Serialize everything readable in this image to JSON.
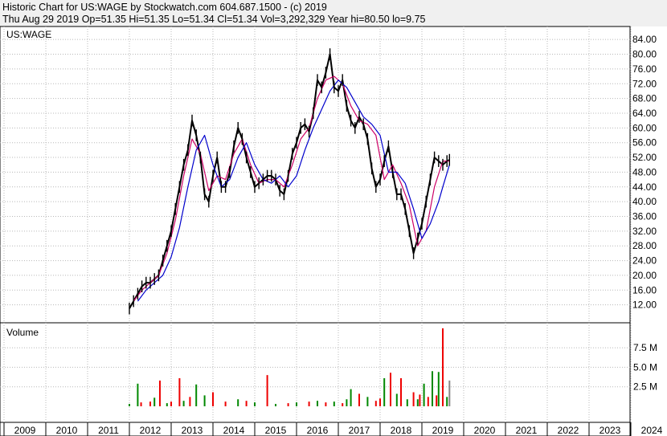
{
  "header": {
    "line1": "Historic Chart for US:WAGE by Stockwatch.com 604.687.1500 - (c) 2019",
    "line2": "Thu Aug 29 2019  Op=51.35  Hi=51.35  Lo=51.34  Cl=51.34  Vol=3,292,329  Year hi=80.50  lo=9.75"
  },
  "chart_data": [
    {
      "type": "line",
      "title": "US:WAGE",
      "ylim": [
        8,
        86
      ],
      "y_ticks": [
        "84.00",
        "80.00",
        "76.00",
        "72.00",
        "68.00",
        "64.00",
        "60.00",
        "56.00",
        "52.00",
        "48.00",
        "44.00",
        "40.00",
        "36.00",
        "32.00",
        "28.00",
        "24.00",
        "20.00",
        "16.00",
        "12.00"
      ],
      "x_ticks": [
        "2009",
        "2010",
        "2011",
        "2012",
        "2013",
        "2014",
        "2015",
        "2016",
        "2017",
        "2018",
        "2019",
        "2020",
        "2021",
        "2022",
        "2023",
        "2024"
      ],
      "grid": true,
      "colors": {
        "price": "#000000",
        "ma_short": "#cc0066",
        "ma_long": "#0000cc"
      },
      "series": [
        {
          "values_x": [
            2012.0,
            2012.1,
            2012.2,
            2012.3,
            2012.4,
            2012.5,
            2012.6,
            2012.7,
            2012.8,
            2012.9,
            2013.0,
            2013.1,
            2013.2,
            2013.3,
            2013.4,
            2013.5,
            2013.6,
            2013.7,
            2013.8,
            2013.9,
            2014.0,
            2014.1,
            2014.2,
            2014.3,
            2014.4,
            2014.5,
            2014.6,
            2014.7,
            2014.8,
            2014.9,
            2015.0,
            2015.1,
            2015.2,
            2015.3,
            2015.4,
            2015.5,
            2015.6,
            2015.7,
            2015.8,
            2015.9,
            2016.0,
            2016.1,
            2016.2,
            2016.3,
            2016.4,
            2016.5,
            2016.6,
            2016.7,
            2016.8,
            2016.9,
            2017.0,
            2017.1,
            2017.2,
            2017.3,
            2017.4,
            2017.5,
            2017.6,
            2017.7,
            2017.8,
            2017.9,
            2018.0,
            2018.1,
            2018.2,
            2018.3,
            2018.4,
            2018.5,
            2018.6,
            2018.7,
            2018.8,
            2018.9,
            2019.0,
            2019.1,
            2019.2,
            2019.3,
            2019.4,
            2019.5,
            2019.6,
            2019.66
          ],
          "values": [
            11,
            13,
            15,
            17,
            18,
            18,
            19,
            20,
            24,
            28,
            32,
            38,
            44,
            50,
            54,
            62,
            58,
            52,
            42,
            40,
            47,
            52,
            44,
            44,
            48,
            55,
            60,
            57,
            52,
            48,
            44,
            45,
            46,
            47,
            47,
            46,
            43,
            42,
            47,
            53,
            56,
            60,
            61,
            59,
            64,
            73,
            71,
            75,
            80,
            71,
            70,
            73,
            66,
            62,
            60,
            63,
            61,
            57,
            49,
            44,
            46,
            51,
            55,
            48,
            42,
            42,
            38,
            32,
            26,
            30,
            34,
            40,
            46,
            52,
            51,
            50,
            51,
            51.34
          ]
        },
        {
          "values_x": [
            2012.1,
            2012.3,
            2012.5,
            2012.7,
            2012.9,
            2013.1,
            2013.3,
            2013.5,
            2013.7,
            2013.9,
            2014.1,
            2014.3,
            2014.5,
            2014.7,
            2014.9,
            2015.1,
            2015.3,
            2015.5,
            2015.7,
            2015.9,
            2016.1,
            2016.3,
            2016.5,
            2016.7,
            2016.9,
            2017.1,
            2017.3,
            2017.5,
            2017.7,
            2017.9,
            2018.1,
            2018.3,
            2018.5,
            2018.7,
            2018.9,
            2019.1,
            2019.3,
            2019.5,
            2019.66
          ],
          "values": [
            13,
            16,
            18,
            20,
            26,
            35,
            47,
            57,
            53,
            43,
            47,
            46,
            53,
            57,
            50,
            45,
            46,
            46,
            44,
            50,
            57,
            60,
            68,
            73,
            74,
            72,
            66,
            62,
            61,
            58,
            46,
            50,
            45,
            39,
            28,
            32,
            44,
            51,
            51
          ]
        },
        {
          "values_x": [
            2012.2,
            2012.4,
            2012.6,
            2012.8,
            2013.0,
            2013.2,
            2013.4,
            2013.6,
            2013.8,
            2014.0,
            2014.2,
            2014.4,
            2014.6,
            2014.8,
            2015.0,
            2015.2,
            2015.4,
            2015.6,
            2015.8,
            2016.0,
            2016.2,
            2016.4,
            2016.6,
            2016.8,
            2017.0,
            2017.2,
            2017.4,
            2017.6,
            2017.8,
            2018.0,
            2018.2,
            2018.4,
            2018.6,
            2018.8,
            2019.0,
            2019.2,
            2019.4,
            2019.5,
            2019.66
          ],
          "values": [
            13,
            16,
            18,
            20,
            25,
            33,
            44,
            54,
            58,
            50,
            44,
            46,
            52,
            56,
            50,
            46,
            45,
            47,
            44,
            47,
            54,
            60,
            65,
            70,
            73,
            71,
            67,
            63,
            61,
            58,
            48,
            48,
            45,
            38,
            30,
            34,
            40,
            44,
            50
          ]
        }
      ]
    },
    {
      "type": "bar",
      "title": "Volume",
      "ylim": [
        0,
        10500000
      ],
      "y_ticks": [
        "7.5 M",
        "5.0 M",
        "2.5 M"
      ],
      "colors": {
        "up": "#008800",
        "down": "#ee0000",
        "last": "#888888"
      },
      "x": [
        2012.0,
        2012.2,
        2012.28,
        2012.5,
        2012.6,
        2012.73,
        2012.9,
        2013.0,
        2013.2,
        2013.3,
        2013.45,
        2013.6,
        2013.8,
        2014.0,
        2014.3,
        2014.6,
        2014.8,
        2015.0,
        2015.3,
        2015.5,
        2015.8,
        2016.0,
        2016.3,
        2016.5,
        2016.7,
        2016.9,
        2017.1,
        2017.2,
        2017.3,
        2017.5,
        2017.7,
        2017.9,
        2018.0,
        2018.1,
        2018.25,
        2018.4,
        2018.5,
        2018.65,
        2018.8,
        2018.9,
        2018.95,
        2019.05,
        2019.15,
        2019.25,
        2019.35,
        2019.4,
        2019.5,
        2019.6,
        2019.66
      ],
      "values": [
        300000,
        2900000,
        500000,
        600000,
        1100000,
        3300000,
        400000,
        600000,
        3600000,
        700000,
        1200000,
        2800000,
        1400000,
        1800000,
        600000,
        900000,
        700000,
        500000,
        4000000,
        300000,
        400000,
        500000,
        600000,
        700000,
        500000,
        600000,
        400000,
        900000,
        2200000,
        1600000,
        1200000,
        700000,
        1000000,
        3600000,
        4300000,
        1600000,
        3600000,
        900000,
        1800000,
        900000,
        1500000,
        2900000,
        1200000,
        4500000,
        1400000,
        4400000,
        10000000,
        1200000,
        3300000
      ],
      "dir": [
        "u",
        "u",
        "d",
        "d",
        "u",
        "d",
        "u",
        "d",
        "d",
        "u",
        "d",
        "u",
        "u",
        "d",
        "d",
        "u",
        "d",
        "u",
        "d",
        "u",
        "d",
        "u",
        "d",
        "u",
        "d",
        "u",
        "d",
        "u",
        "u",
        "d",
        "u",
        "d",
        "d",
        "u",
        "d",
        "u",
        "d",
        "u",
        "d",
        "u",
        "d",
        "u",
        "d",
        "u",
        "d",
        "u",
        "d",
        "u",
        "l"
      ]
    }
  ]
}
